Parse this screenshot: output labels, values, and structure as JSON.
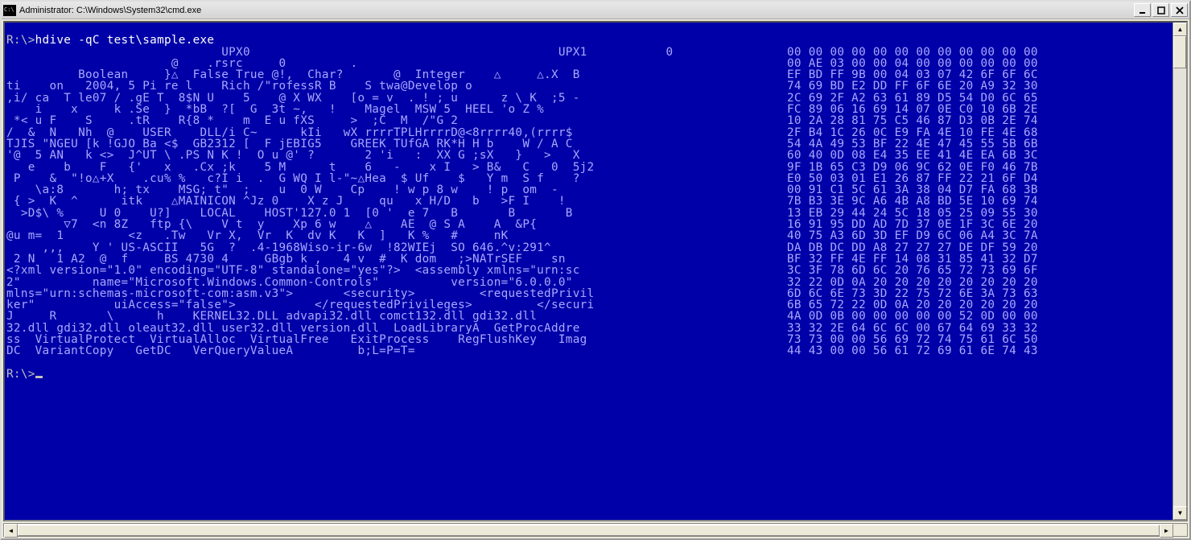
{
  "window": {
    "title": "Administrator: C:\\Windows\\System32\\cmd.exe"
  },
  "prompt1": "R:\\>",
  "command": "hdive -qC test\\sample.exe",
  "prompt2": "R:\\>",
  "rows": [
    {
      "l": "                              UPX0                                           UPX1           0    ",
      "r": "00 00 00 00 00 00 00 00 00 00 00 00"
    },
    {
      "l": "                       @    .rsrc     0         .                                                ",
      "r": "00 AE 03 00 00 04 00 00 00 00 00 00"
    },
    {
      "l": "          Boolean     }△  False True @!,  Char?       @  Integer    △     △.X  B   ",
      "r": "EF BD FF 9B 00 04 03 07 42 6F 6F 6C"
    },
    {
      "l": "ti    on   2004, 5 Pi re l    Rich /\"rofessR B    S twa@Develop o                 ",
      "r": "74 69 BD E2 DD FF 6F 6E 20 A9 32 30"
    },
    {
      "l": ",i/ ca  T le07 / .gE T  8$N U    5    @ X WX    [o = v_ . ! ; u      z \\ K  ;5 -  ",
      "r": "2C 69 2F A2 63 61 89 D5 54 D0 6C 65"
    },
    {
      "l": "    i    x     k .Se  }  *bB  ?[  G  3t ~,   !    Magel  MSW 5  HEEL 'o Z %       ",
      "r": "FC 89 06 16 69 14 07 0E C0 10 6B 2E"
    },
    {
      "l": " *< u F    S     .tR    R{8 *    m  E u fXS     >  ;C  M  /\"G 2                   ",
      "r": "10 2A 28 81 75 C5 46 87 D3 0B 2E 74"
    },
    {
      "l": "/  &  N   Nh  @    USER    DLL/i C~      kIi   wX rrrrTPLHrrrrD@<8rrrr40,(rrrr$   ",
      "r": "2F B4 1C 26 0C E9 FA 4E 10 FE 4E 68"
    },
    {
      "l": "TJIS \"NGEU [k !GJO Ba <$  GB2312 [  F jEBIG5    GREEK TUfGA RK*H H b    W / A C   ",
      "r": "54 4A 49 53 BF 22 4E 47 45 55 5B 6B"
    },
    {
      "l": "'@  5 AN   k <>  J^UT \\ .PS N K !  O u @' ?       2 'i   :  XX G ;sX   }   >   X  ",
      "r": "60 40 0D 08 E4 35 EE 41 4E EA 6B 3C"
    },
    {
      "l": "   e    b    F   {'   x   .Cx ;k    5 M      t    6   -    x I   > B&   C   0  5j2",
      "r": "9F 1B 65 C3 D9 06 9C 62 0E F0 46 7B"
    },
    {
      "l": " P    &  \"!o△+X    .cu% %   c?I i  .  G WQ I l-\"~△Hea  $ Uf    $   Y m  S f    ?  ",
      "r": "E0 50 03 01 E1 26 87 FF 22 21 6F D4"
    },
    {
      "l": "    \\a:8       h; tx    MSG; t\"  ;    u  0 W    Cp    ! w p 8 w    ! p  om  -     ",
      "r": "00 91 C1 5C 61 3A 38 04 D7 FA 68 3B"
    },
    {
      "l": " { >  K  ^      itk    △MAINICON ^Jz 0    X z J     qu   x H/D   b   >F I    !    ",
      "r": "7B B3 3E 9C A6 4B A8 BD 5E 10 69 74"
    },
    {
      "l": "  >D$\\ %     U 0    U?]    LOCAL    HOST'127.0 1  [0 '  e 7   B       B       B   ",
      "r": "13 EB 29 44 24 5C 18 05 25 09 55 30"
    },
    {
      "l": "        ▽7  <n 8Z   ftp {\\    V t  y    Xp 6 w    △    AE  @ S A    A  &P{        ",
      "r": "16 91 95 DD AD 7D 37 0E 1F 3C 6E 20"
    },
    {
      "l": "@u m=  1         <z   .Tw   Vr X,  Vr  K  dv K   K  ]   K %   #     nK            ",
      "r": "40 75 A3 6D 3D EF D9 6C 06 A4 3C 7A"
    },
    {
      "l": "     ,,,    Y ' US-ASCII   5G  ?  .4-1968Wiso-ir-6w  !82WIEj  SO_646.^v:291^      ",
      "r": "DA DB DC DD A8 27 27 27 DE DF 59 20"
    },
    {
      "l": " 2 N   1 A2  @  f     BS_4730 4     GBgb k ,   4 v  #  K dom   ;>NATrSEF    sn    ",
      "r": "BF 32 FF 4E FF 14 08 31 85 41 32 D7"
    },
    {
      "l": "<?xml version=\"1.0\" encoding=\"UTF-8\" standalone=\"yes\"?>  <assembly xmlns=\"urn:sc  ",
      "r": "3C 3F 78 6D 6C 20 76 65 72 73 69 6F"
    },
    {
      "l": "2\"          name=\"Microsoft.Windows.Common-Controls\"          version=\"6.0.0.0\"   ",
      "r": "32 22 0D 0A 20 20 20 20 20 20 20 20"
    },
    {
      "l": "mlns=\"urn:schemas-microsoft-com:asm.v3\">       <security>         <requestedPrivil",
      "r": "6D 6C 6E 73 3D 22 75 72 6E 3A 73 63"
    },
    {
      "l": "ker\"           uiAccess=\"false\">           </requestedPrivileges>         </securi",
      "r": "6B 65 72 22 0D 0A 20 20 20 20 20 20"
    },
    {
      "l": "J     R       \\      h    KERNEL32.DLL advapi32.dll comct132.dll gdi32.dll        ",
      "r": "4A 0D 0B 00 00 00 00 00 52 0D 00 00"
    },
    {
      "l": "32.dll gdi32.dll oleaut32.dll user32.dll version.dll  LoadLibraryA  GetProcAddre  ",
      "r": "33 32 2E 64 6C 6C 00 67 64 69 33 32"
    },
    {
      "l": "ss  VirtualProtect  VirtualAlloc  VirtualFree   ExitProcess    RegFlushKey   Imag ",
      "r": "73 73 00 00 56 69 72 74 75 61 6C 50"
    },
    {
      "l": "DC  VariantCopy   GetDC   VerQueryValueA         b;L=P=T=                         ",
      "r": "44 43 00 00 56 61 72 69 61 6E 74 43"
    }
  ]
}
